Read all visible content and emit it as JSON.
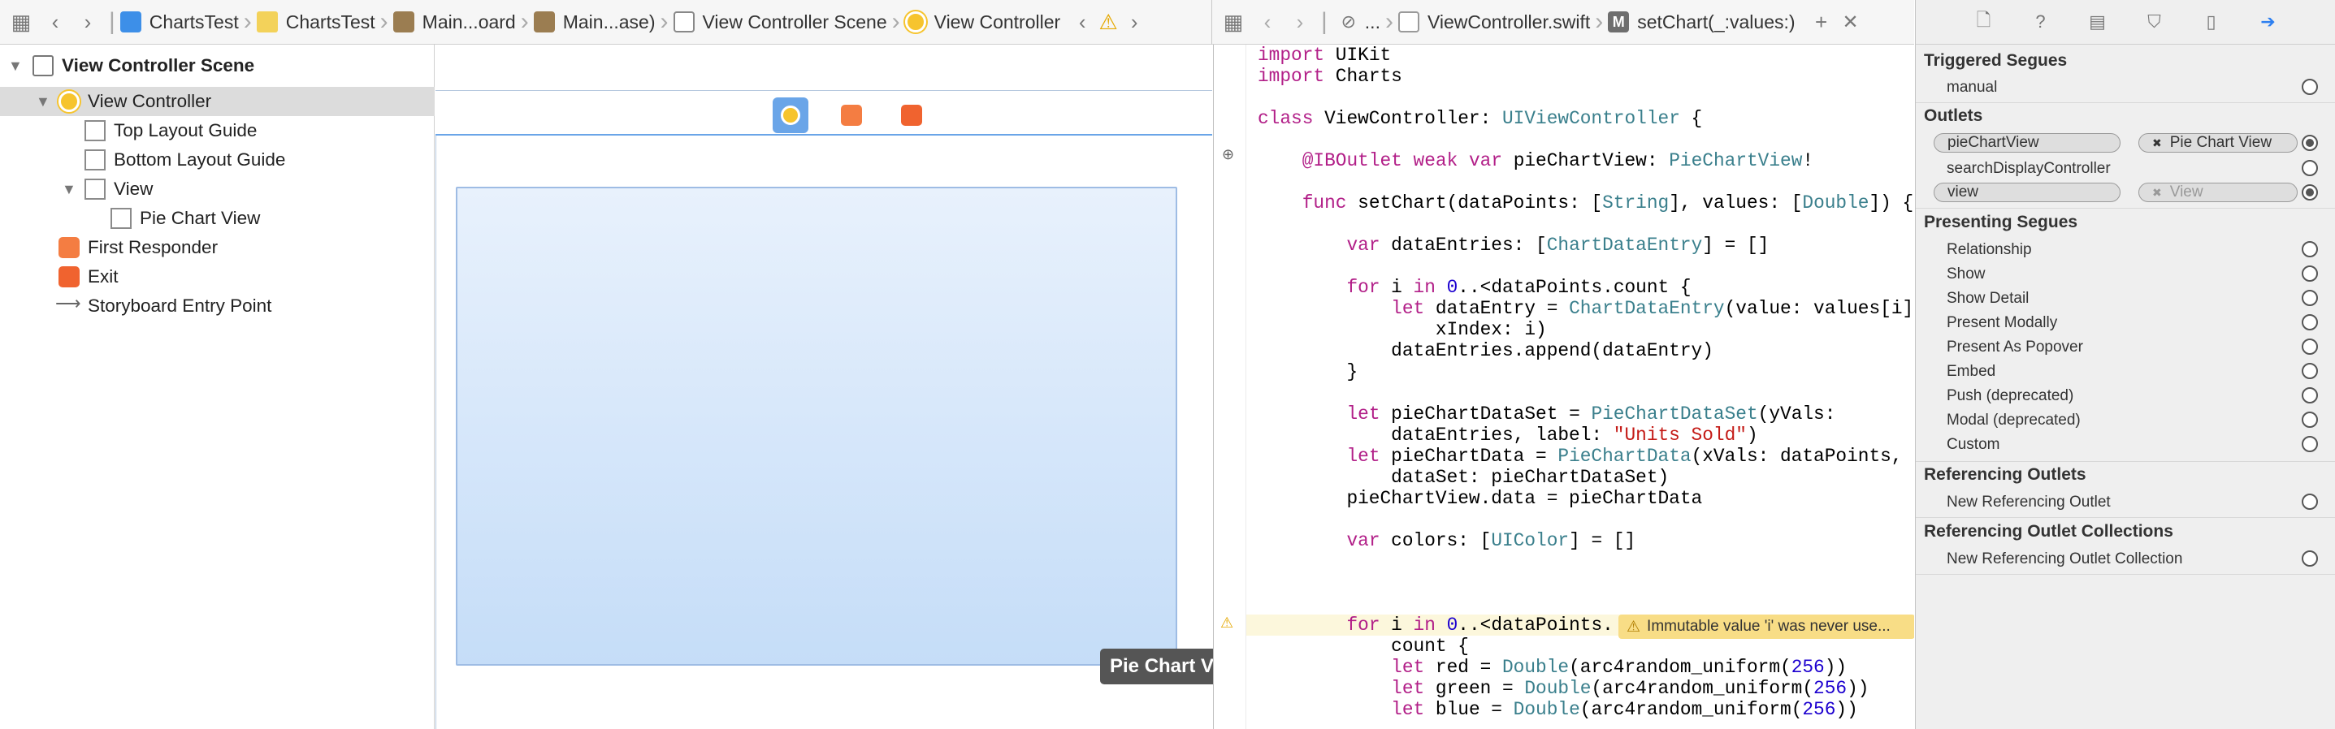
{
  "toolbar_left": {
    "crumbs": [
      "ChartsTest",
      "ChartsTest",
      "Main...oard",
      "Main...ase)",
      "View Controller Scene",
      "View Controller"
    ]
  },
  "toolbar_right": {
    "crumbs": [
      "...",
      "ViewController.swift",
      "setChart(_:values:)"
    ],
    "method_badge": "M"
  },
  "outline": {
    "scene": "View Controller Scene",
    "items": [
      "View Controller",
      "Top Layout Guide",
      "Bottom Layout Guide",
      "View",
      "Pie Chart View",
      "First Responder",
      "Exit",
      "Storyboard Entry Point"
    ]
  },
  "canvas": {
    "tooltip": "Pie Chart View"
  },
  "code_lines": [
    "import UIKit",
    "import Charts",
    "",
    "class ViewController: UIViewController {",
    "",
    "    @IBOutlet weak var pieChartView: PieChartView!",
    "",
    "    func setChart(dataPoints: [String], values: [Double]) {",
    "",
    "        var dataEntries: [ChartDataEntry] = []",
    "",
    "        for i in 0..<dataPoints.count {",
    "            let dataEntry = ChartDataEntry(value: values[i],",
    "                xIndex: i)",
    "            dataEntries.append(dataEntry)",
    "        }",
    "",
    "        let pieChartDataSet = PieChartDataSet(yVals:",
    "            dataEntries, label: \"Units Sold\")",
    "        let pieChartData = PieChartData(xVals: dataPoints,",
    "            dataSet: pieChartDataSet)",
    "        pieChartView.data = pieChartData",
    "",
    "        var colors: [UIColor] = []",
    "",
    "",
    "",
    "        for i in 0..<dataPoints.",
    "            count {",
    "            let red = Double(arc4random_uniform(256))",
    "            let green = Double(arc4random_uniform(256))",
    "            let blue = Double(arc4random_uniform(256))"
  ],
  "warning": "Immutable value 'i' was never use...",
  "inspector": {
    "triggered_segues_title": "Triggered Segues",
    "triggered": [
      "manual"
    ],
    "outlets_title": "Outlets",
    "outlets": [
      {
        "name": "pieChartView",
        "target": "Pie Chart View",
        "connected": true
      },
      {
        "name": "searchDisplayController",
        "target": "",
        "connected": false
      },
      {
        "name": "view",
        "target": "View",
        "connected": true
      }
    ],
    "presenting_title": "Presenting Segues",
    "presenting": [
      "Relationship",
      "Show",
      "Show Detail",
      "Present Modally",
      "Present As Popover",
      "Embed",
      "Push (deprecated)",
      "Modal (deprecated)",
      "Custom"
    ],
    "ref_outlets_title": "Referencing Outlets",
    "ref_outlets": [
      "New Referencing Outlet"
    ],
    "ref_collections_title": "Referencing Outlet Collections",
    "ref_collections": [
      "New Referencing Outlet Collection"
    ]
  },
  "colors": {
    "accent": "#2d7ff0",
    "vc_icon": "#f6c42e",
    "responder": "#f47d42",
    "warning_bg": "#f8dd86"
  }
}
